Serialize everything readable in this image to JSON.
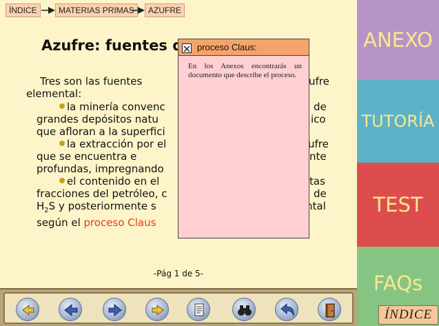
{
  "breadcrumb": {
    "home": "ÍNDICE",
    "level1": "MATERIAS PRIMAS",
    "level2": "AZUFRE"
  },
  "article": {
    "title": "Azufre: fuentes d",
    "lines": {
      "l1": "Tres son las fuentes",
      "l1_end": "ufre",
      "l2": "elemental:",
      "b1_start": "la minería convenc",
      "b1_end": "de",
      "b1_l2": "grandes depósitos natu",
      "b1_l2_end": "ico",
      "b1_l3": "que afloran a la superfici",
      "b2_start": "la extracción por el",
      "b2_end": "ufre",
      "b2_l2": "que   se   encuentra   e",
      "b2_l2_end": "nte",
      "b2_l3": "profundas, impregnando",
      "b3_start": "el contenido en el",
      "b3_end": "tas",
      "b3_l2": "fracciones del petróleo, c",
      "b3_l2_end": "de",
      "b3_l3_a": "H",
      "b3_l3_sub": "2",
      "b3_l3_b": "S  y  posteriormente  s",
      "b3_l3_end": "ntal",
      "b3_l4": "según el ",
      "link": "proceso Claus"
    },
    "page_info": "-Pág 1 de 5-"
  },
  "popup": {
    "title": "proceso Claus:",
    "body": "En los Anexos encontrarás un documento que describe el proceso."
  },
  "side": {
    "anexo": "ANEXO",
    "tutoria": "TUTORÍA",
    "test": "TEST",
    "faqs": "FAQs",
    "indice": "ÍNDICE"
  },
  "toolbar": {
    "icons": [
      "first-page-icon",
      "prev-page-icon",
      "next-page-icon",
      "last-page-icon",
      "notes-icon",
      "search-binoculars-icon",
      "back-icon",
      "exit-door-icon"
    ]
  },
  "colors": {
    "background": "#fdf5c9",
    "anexo": "#b694c6",
    "tutoria": "#5db1c8",
    "test": "#dd4d4d",
    "faqs": "#86c483",
    "side_text": "#f6ea8d",
    "popup_bg": "#ffcfd2",
    "popup_header": "#f4a46a",
    "link": "#e23a1a"
  }
}
